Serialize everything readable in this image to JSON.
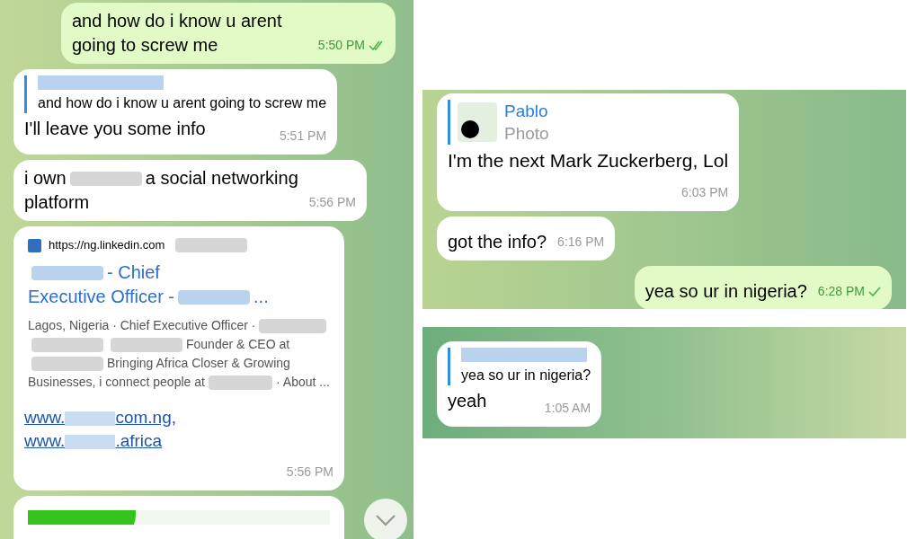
{
  "left_chat": {
    "messages": [
      {
        "kind": "text",
        "outgoing": true,
        "text": "and how do i know u arent going to screw me",
        "time": "5:50 PM",
        "read": true
      },
      {
        "kind": "reply",
        "outgoing": false,
        "quote": "and how do i know u arent going to screw me",
        "text": "I'll leave you some info",
        "time": "5:51 PM"
      },
      {
        "kind": "redacted_text",
        "outgoing": false,
        "lines": [
          [
            {
              "kind": "text",
              "text": "i own"
            },
            {
              "kind": "redacted"
            },
            {
              "kind": "text",
              "text": "a social networking"
            }
          ],
          [
            {
              "kind": "text",
              "text": "platform"
            }
          ]
        ],
        "time": "5:56 PM"
      },
      {
        "kind": "link_preview",
        "outgoing": false,
        "url": "https://ng.linkedin.com",
        "title": [
          [
            {
              "kind": "redacted"
            },
            {
              "kind": "text",
              "text": "- Chief"
            }
          ],
          [
            {
              "kind": "text",
              "text": "Executive Officer -"
            },
            {
              "kind": "redacted"
            },
            {
              "kind": "text",
              "text": "..."
            }
          ]
        ],
        "description": [
          [
            {
              "kind": "text",
              "text": "Lagos, Nigeria · Chief Executive Officer ·"
            },
            {
              "kind": "redacted"
            }
          ],
          [
            {
              "kind": "redacted"
            },
            {
              "kind": "redacted"
            },
            {
              "kind": "text",
              "text": "Founder & CEO at"
            }
          ],
          [
            {
              "kind": "redacted"
            },
            {
              "kind": "text",
              "text": "Bringing Africa Closer & Growing"
            }
          ],
          [
            {
              "kind": "text",
              "text": "Businesses, i connect people at"
            },
            {
              "kind": "redacted"
            },
            {
              "kind": "text",
              "text": "· About ..."
            }
          ]
        ],
        "links": [
          [
            {
              "kind": "text",
              "text": "www."
            },
            {
              "kind": "redacted"
            },
            {
              "kind": "text",
              "text": "com.ng,"
            }
          ],
          [
            {
              "kind": "text",
              "text": "www."
            },
            {
              "kind": "redacted"
            },
            {
              "kind": "text",
              "text": ".africa"
            }
          ]
        ],
        "time": "5:56 PM"
      },
      {
        "kind": "image",
        "outgoing": false
      }
    ]
  },
  "right_chat_top": {
    "messages": [
      {
        "kind": "photo_reply",
        "outgoing": false,
        "sender": "Pablo",
        "quote": "Photo",
        "text": "I'm the next Mark Zuckerberg, Lol",
        "time": "6:03 PM"
      },
      {
        "kind": "text",
        "outgoing": false,
        "text": "got the info?",
        "time": "6:16 PM"
      },
      {
        "kind": "text",
        "outgoing": true,
        "text": "yea so ur in nigeria?",
        "time": "6:28 PM",
        "read": false
      }
    ]
  },
  "right_chat_bottom": {
    "messages": [
      {
        "kind": "reply",
        "outgoing": false,
        "quote": "yea so ur in nigeria?",
        "text": "yeah",
        "time": "1:05 AM"
      }
    ]
  }
}
